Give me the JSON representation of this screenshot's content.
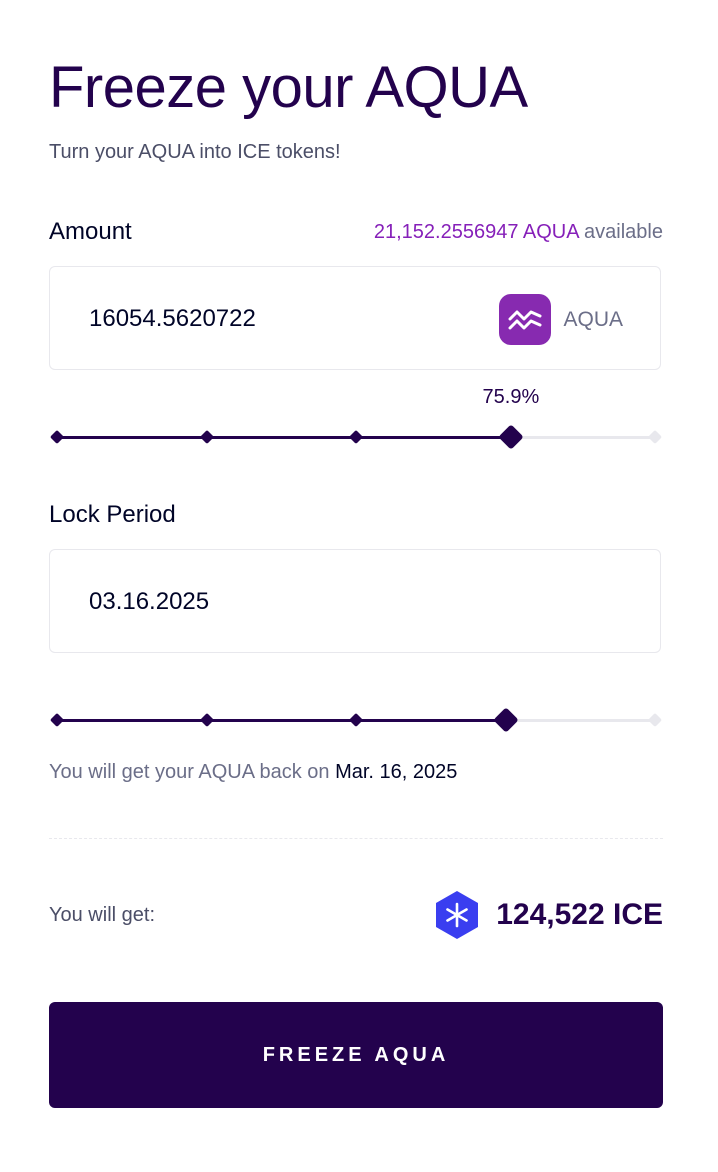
{
  "header": {
    "title": "Freeze your AQUA",
    "subtitle": "Turn your AQUA into ICE tokens!"
  },
  "amount": {
    "label": "Amount",
    "available_amount": "21,152.2556947 AQUA",
    "available_suffix": " available",
    "value": "16054.5620722",
    "asset_code": "AQUA",
    "asset_icon": "aqua-logo-icon",
    "slider_percent_label": "75.9%",
    "slider_fraction": 0.759,
    "slider_marks": [
      0,
      0.25,
      0.5,
      0.75,
      1
    ]
  },
  "lock": {
    "label": "Lock Period",
    "value": "03.16.2025",
    "slider_fraction": 0.75,
    "slider_marks": [
      0,
      0.25,
      0.5,
      0.75,
      1
    ],
    "return_prefix": "You will get your AQUA back on ",
    "return_date": "Mar. 16, 2025"
  },
  "result": {
    "label": "You will get:",
    "amount": "124,522 ICE",
    "icon": "ice-token-icon"
  },
  "cta": {
    "label": "FREEZE AQUA"
  },
  "colors": {
    "primary": "#23024d",
    "accent": "#8620b9",
    "aqua_logo": "#872ab0",
    "ice_logo": "#3a3ef0",
    "muted": "#6b6e88",
    "border": "#e8e8ed"
  }
}
